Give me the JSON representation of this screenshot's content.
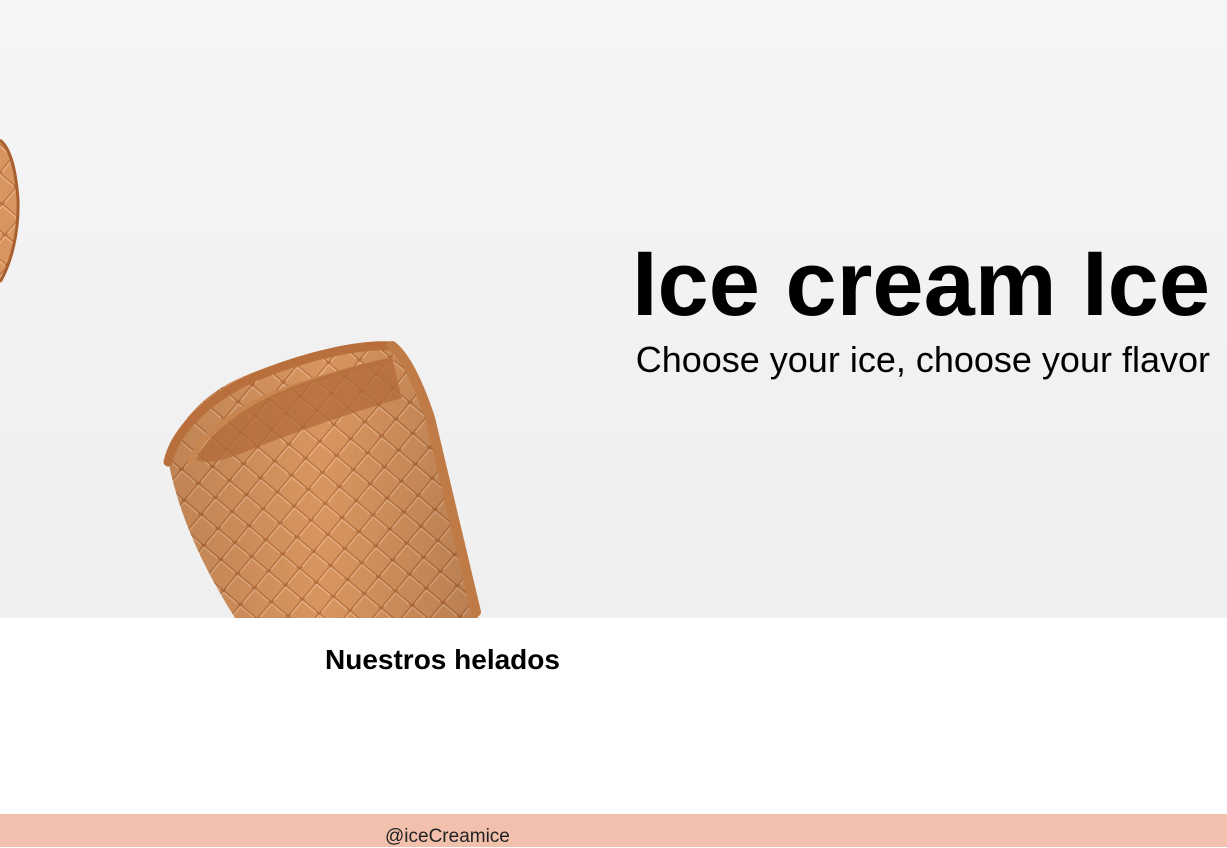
{
  "hero": {
    "title": "Ice cream Ice",
    "subtitle": "Choose your ice, choose your flavor",
    "background_color": "#f3f2f3",
    "image_subject": "waffle-cone-icon"
  },
  "section": {
    "title": "Nuestros helados"
  },
  "footer": {
    "handle": "@iceCreamice",
    "background_color": "#f1c1ad"
  }
}
